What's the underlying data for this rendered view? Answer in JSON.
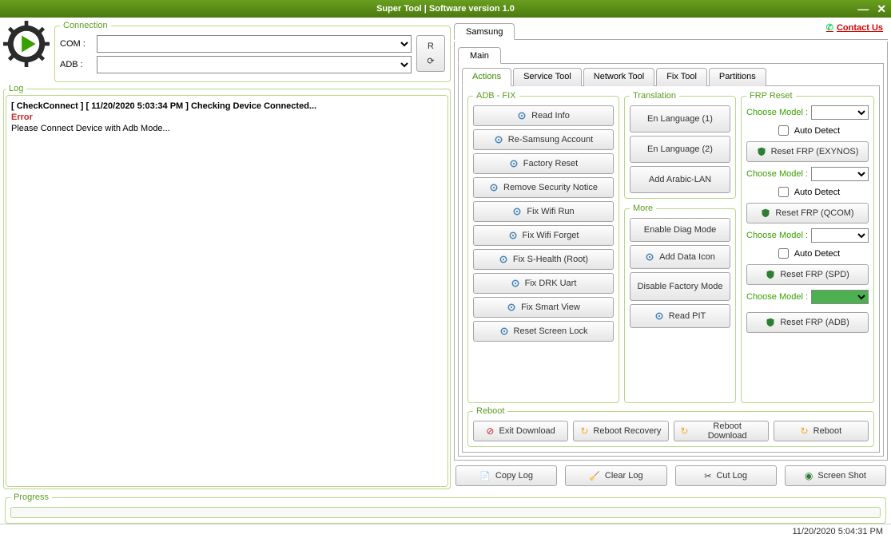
{
  "title": "Super Tool | Software version 1.0",
  "contact": "Contact Us",
  "connection": {
    "legend": "Connection",
    "com_label": "COM :",
    "adb_label": "ADB :",
    "r_label": "R"
  },
  "log": {
    "legend": "Log",
    "line1": "[ CheckConnect ] [ 11/20/2020 5:03:34 PM ] Checking Device Connected...",
    "line2": "Error",
    "line3": "Please Connect Device with Adb Mode..."
  },
  "progress_legend": "Progress",
  "statusbar_time": "11/20/2020 5:04:31 PM",
  "brand_tab": "Samsung",
  "main_tab": "Main",
  "subtabs": [
    "Actions",
    "Service Tool",
    "Network Tool",
    "Fix Tool",
    "Partitions"
  ],
  "adb_fix": {
    "legend": "ADB - FIX",
    "buttons": [
      "Read Info",
      "Re-Samsung Account",
      "Factory Reset",
      "Remove Security Notice",
      "Fix Wifi Run",
      "Fix Wifi Forget",
      "Fix S-Health (Root)",
      "Fix DRK Uart",
      "Fix Smart View",
      "Reset Screen Lock"
    ]
  },
  "translation": {
    "legend": "Translation",
    "buttons": [
      "En Language (1)",
      "En Language (2)",
      "Add Arabic-LAN"
    ]
  },
  "more": {
    "legend": "More",
    "buttons": [
      "Enable Diag Mode",
      "Add Data Icon",
      "Disable Factory Mode",
      "Read PIT"
    ]
  },
  "frp": {
    "legend": "FRP Reset",
    "choose_model": "Choose Model :",
    "auto_detect": "Auto Detect",
    "btn1": "Reset FRP (EXYNOS)",
    "btn2": "Reset FRP (QCOM)",
    "btn3": "Reset FRP (SPD)",
    "btn4": "Reset FRP (ADB)"
  },
  "reboot": {
    "legend": "Reboot",
    "exit_download": "Exit Download",
    "recovery": "Reboot Recovery",
    "download": "Reboot Download",
    "reboot": "Reboot"
  },
  "bottom": {
    "copy": "Copy Log",
    "clear": "Clear Log",
    "cut": "Cut Log",
    "screenshot": "Screen Shot"
  }
}
